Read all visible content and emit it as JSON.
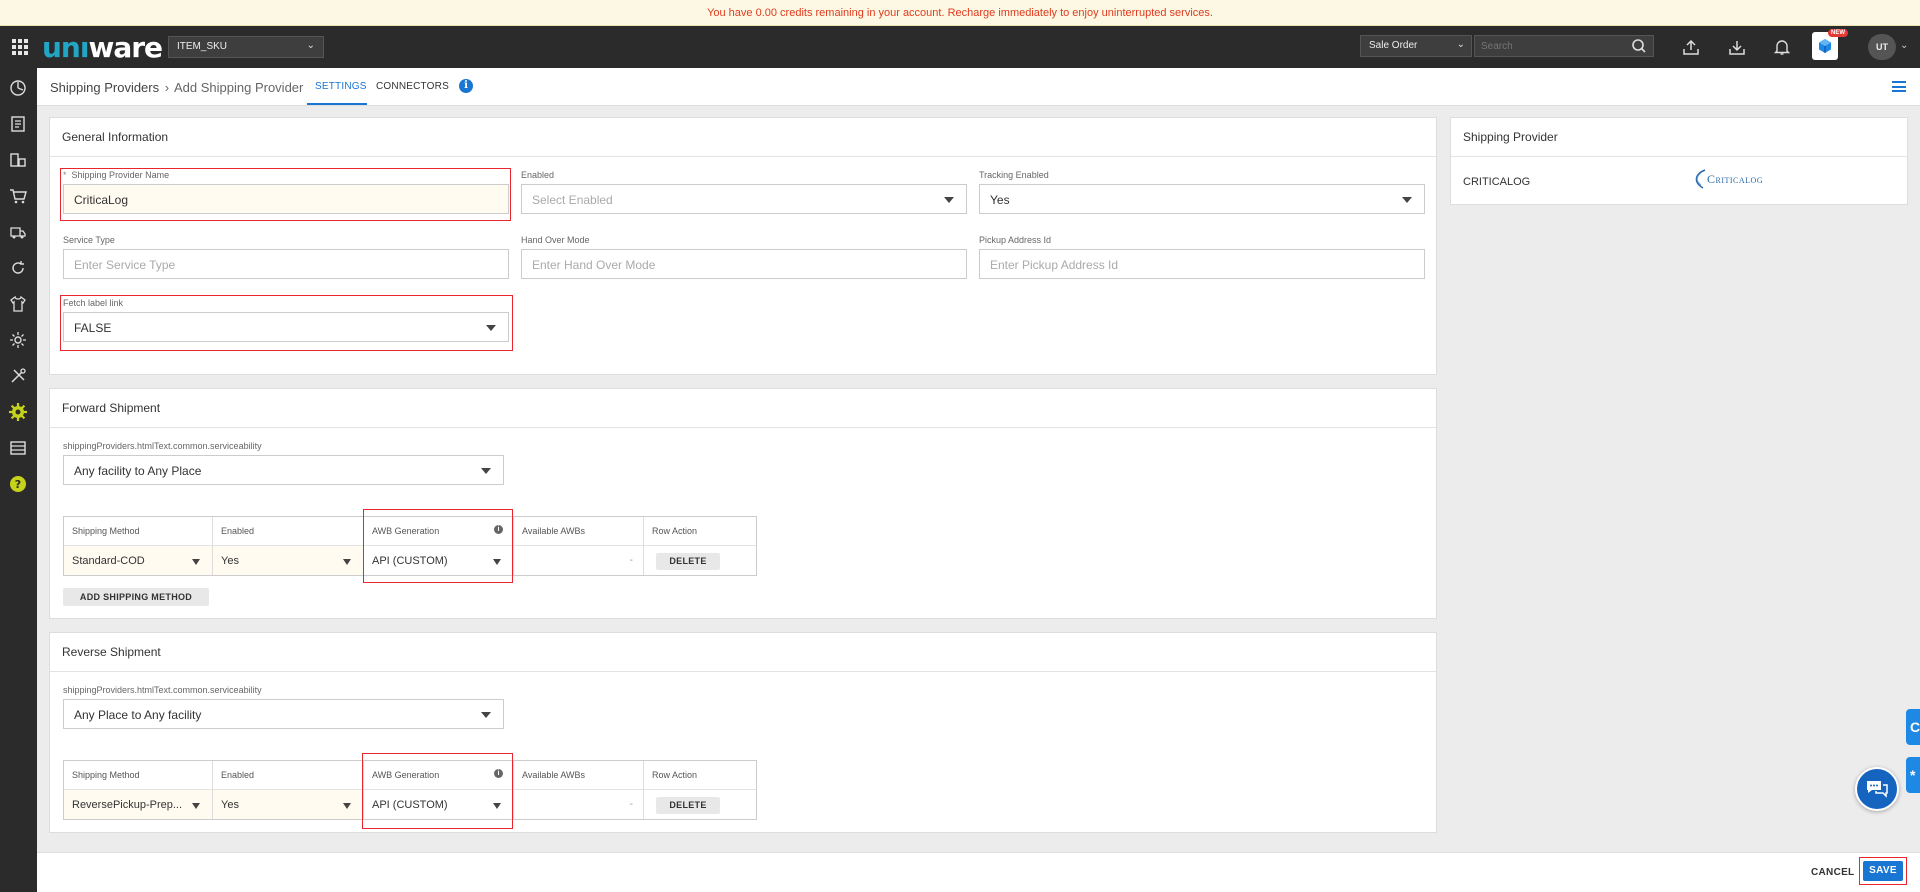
{
  "banner": {
    "message": "You have 0.00 credits remaining in your account. Recharge immediately to enjoy uninterrupted services."
  },
  "topbar": {
    "logo_a": "unı",
    "logo_b": "ware",
    "facility_select": "ITEM_SKU",
    "order_type_select": "Sale Order",
    "search_placeholder": "Search",
    "new_badge": "NEW",
    "avatar_initials": "UT"
  },
  "header": {
    "breadcrumb_root": "Shipping Providers",
    "breadcrumb_separator": "›",
    "breadcrumb_current": "Add Shipping Provider",
    "tabs": {
      "settings": "SETTINGS",
      "connectors": "CONNECTORS"
    },
    "info_symbol": "i"
  },
  "general": {
    "title": "General Information",
    "provider_name": {
      "required_mark": "*",
      "label": "Shipping Provider Name",
      "value": "CriticaLog"
    },
    "enabled": {
      "label": "Enabled",
      "placeholder": "Select Enabled"
    },
    "tracking_enabled": {
      "label": "Tracking Enabled",
      "value": "Yes"
    },
    "service_type": {
      "label": "Service Type",
      "placeholder": "Enter Service Type"
    },
    "hand_over_mode": {
      "label": "Hand Over Mode",
      "placeholder": "Enter Hand Over Mode"
    },
    "pickup_address_id": {
      "label": "Pickup Address Id",
      "placeholder": "Enter Pickup Address Id"
    },
    "fetch_label_link": {
      "label": "Fetch label link",
      "value": "FALSE"
    }
  },
  "forward": {
    "title": "Forward Shipment",
    "serviceability_label": "shippingProviders.htmlText.common.serviceability",
    "serviceability_value": "Any facility to Any Place",
    "headers": {
      "method": "Shipping Method",
      "enabled": "Enabled",
      "awb": "AWB Generation",
      "available": "Available AWBs",
      "action": "Row Action"
    },
    "row": {
      "method": "Standard-COD",
      "enabled": "Yes",
      "awb": "API (CUSTOM)",
      "available": "-",
      "action": "DELETE"
    },
    "add_button": "ADD SHIPPING METHOD"
  },
  "reverse": {
    "title": "Reverse Shipment",
    "serviceability_label": "shippingProviders.htmlText.common.serviceability",
    "serviceability_value": "Any Place to Any facility",
    "headers": {
      "method": "Shipping Method",
      "enabled": "Enabled",
      "awb": "AWB Generation",
      "available": "Available AWBs",
      "action": "Row Action"
    },
    "row": {
      "method": "ReversePickup-Prep...",
      "enabled": "Yes",
      "awb": "API (CUSTOM)",
      "available": "-",
      "action": "DELETE"
    }
  },
  "provider_panel": {
    "title": "Shipping Provider",
    "name": "CRITICALOG",
    "logo_text": "Criticalog"
  },
  "footer": {
    "cancel": "CANCEL",
    "save": "SAVE"
  },
  "widgets": {
    "edge_top_glyph": "C",
    "edge_bottom_glyph": "*"
  },
  "colors": {
    "accent": "#1976d2",
    "highlight": "#e8262e",
    "banner_text": "#e03a1e",
    "topbar": "#2b2b2b"
  }
}
